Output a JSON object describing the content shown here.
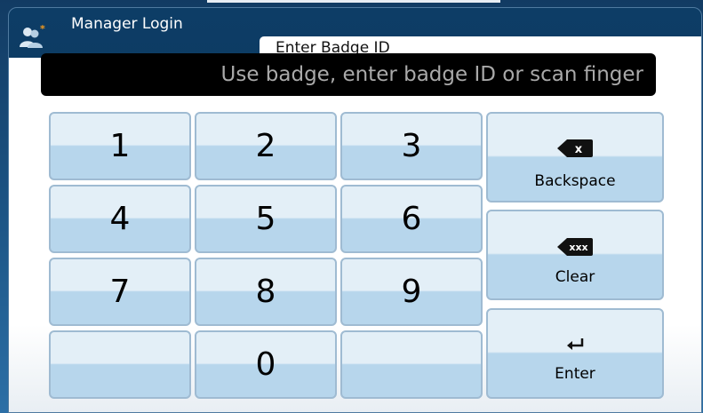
{
  "window": {
    "title": "Manager Login"
  },
  "tab": {
    "label": "Enter Badge ID"
  },
  "display": {
    "prompt": "Use badge, enter badge ID or scan finger"
  },
  "keypad": {
    "k1": "1",
    "k2": "2",
    "k3": "3",
    "k4": "4",
    "k5": "5",
    "k6": "6",
    "k7": "7",
    "k8": "8",
    "k9": "9",
    "k0": "0"
  },
  "actions": {
    "backspace": {
      "label": "Backspace",
      "icon": "backspace-icon",
      "glyph": "x"
    },
    "clear": {
      "label": "Clear",
      "icon": "clear-icon",
      "glyph": "xxx"
    },
    "enter": {
      "label": "Enter",
      "icon": "enter-icon"
    }
  },
  "colors": {
    "header": "#0d3d66",
    "display_bg": "#000000",
    "display_text": "#a9a9a9",
    "key_top": "#e3eff7",
    "key_bottom": "#b7d6ec",
    "key_border": "#9fbbd2"
  }
}
